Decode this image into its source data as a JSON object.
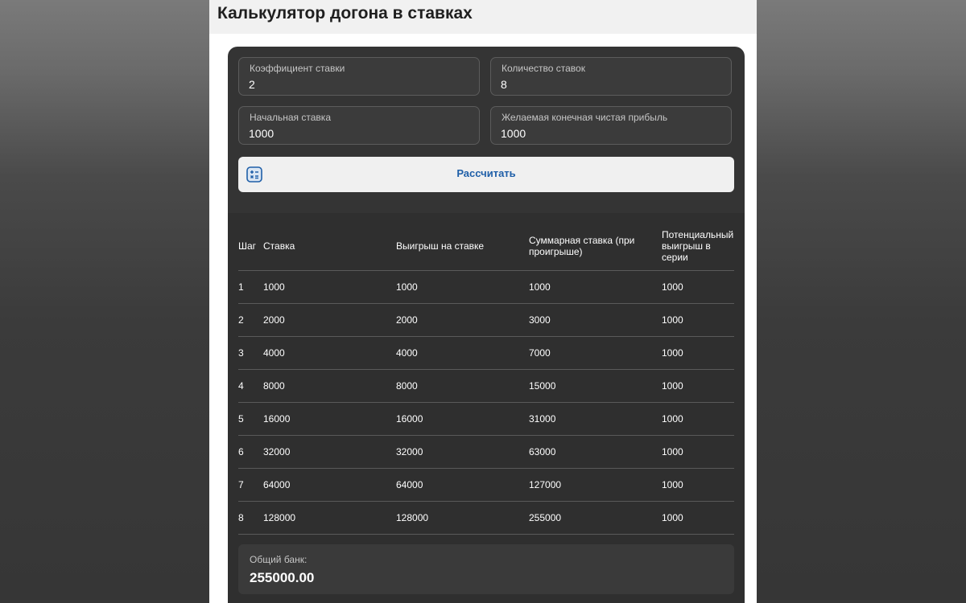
{
  "page": {
    "title": "Калькулятор догона в ставках"
  },
  "form": {
    "coefficient": {
      "label": "Коэффициент ставки",
      "value": "2"
    },
    "bets_count": {
      "label": "Количество ставок",
      "value": "8"
    },
    "initial_bet": {
      "label": "Начальная ставка",
      "value": "1000"
    },
    "desired_profit": {
      "label": "Желаемая конечная чистая прибыль",
      "value": "1000"
    },
    "calculate": {
      "label": "Рассчитать",
      "icon": "calculator-icon"
    }
  },
  "colors": {
    "accent": "#1f5fa8",
    "card_bg": "#343434",
    "results_bg": "#2f2f2f"
  },
  "table": {
    "headers": [
      "Шаг",
      "Ставка",
      "Выигрыш на ставке",
      "Суммарная ставка (при проигрыше)",
      "Потенциальный выигрыш в серии"
    ],
    "rows": [
      [
        "1",
        "1000",
        "1000",
        "1000",
        "1000"
      ],
      [
        "2",
        "2000",
        "2000",
        "3000",
        "1000"
      ],
      [
        "3",
        "4000",
        "4000",
        "7000",
        "1000"
      ],
      [
        "4",
        "8000",
        "8000",
        "15000",
        "1000"
      ],
      [
        "5",
        "16000",
        "16000",
        "31000",
        "1000"
      ],
      [
        "6",
        "32000",
        "32000",
        "63000",
        "1000"
      ],
      [
        "7",
        "64000",
        "64000",
        "127000",
        "1000"
      ],
      [
        "8",
        "128000",
        "128000",
        "255000",
        "1000"
      ]
    ]
  },
  "bank": {
    "label": "Общий банк:",
    "value": "255000.00"
  }
}
